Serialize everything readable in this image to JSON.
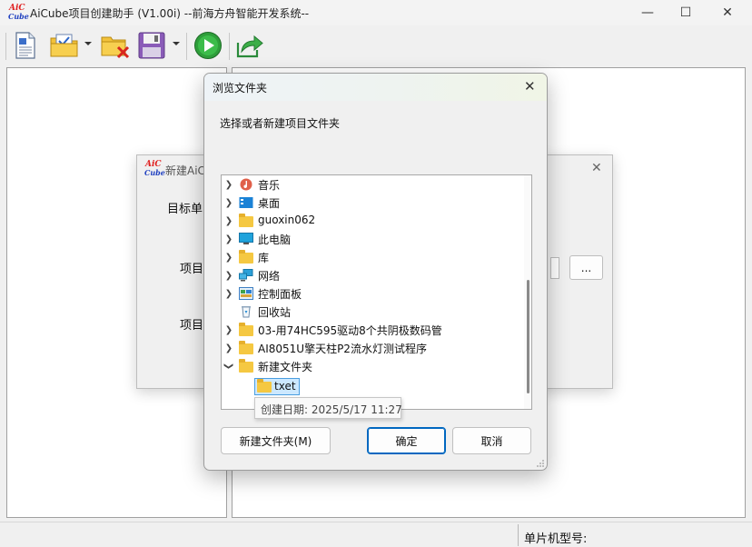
{
  "window": {
    "title": "AiCube项目创建助手 (V1.00i) --前海方舟智能开发系统--",
    "logo_top": "AiC",
    "logo_bottom": "Cube",
    "minimize": "—",
    "maximize": "☐",
    "close": "✕"
  },
  "toolbar": {
    "items": [
      "new-document-icon",
      "open-project-icon",
      "delete-folder-icon",
      "save-icon",
      "run-icon",
      "export-icon"
    ]
  },
  "status": {
    "mcu_label": "单片机型号:"
  },
  "bg_dialog": {
    "title": "新建AiC",
    "target_label": "目标单",
    "project_label_1": "项目",
    "project_label_2": "项目",
    "browse_button": "..."
  },
  "browse_dialog": {
    "title": "浏览文件夹",
    "close": "✕",
    "prompt": "选择或者新建项目文件夹",
    "tree": [
      {
        "label": "音乐",
        "icon": "music-icon",
        "expanded": false
      },
      {
        "label": "桌面",
        "icon": "desktop-icon",
        "expanded": false
      },
      {
        "label": "guoxin062",
        "icon": "folder-icon",
        "expanded": false
      },
      {
        "label": "此电脑",
        "icon": "computer-icon",
        "expanded": false
      },
      {
        "label": "库",
        "icon": "library-icon",
        "expanded": false
      },
      {
        "label": "网络",
        "icon": "network-icon",
        "expanded": false
      },
      {
        "label": "控制面板",
        "icon": "control-panel-icon",
        "expanded": false
      },
      {
        "label": "回收站",
        "icon": "recycle-bin-icon",
        "expanded": null
      },
      {
        "label": "03-用74HC595驱动8个共阴极数码管",
        "icon": "folder-icon",
        "expanded": false
      },
      {
        "label": "AI8051U擎天柱P2流水灯测试程序",
        "icon": "folder-icon",
        "expanded": false
      },
      {
        "label": "新建文件夹",
        "icon": "folder-icon",
        "expanded": true
      }
    ],
    "selected_child": "txet",
    "tooltip": "创建日期: 2025/5/17 11:27",
    "new_folder_button": "新建文件夹(M)",
    "ok_button": "确定",
    "cancel_button": "取消"
  },
  "colors": {
    "accent": "#0067c0",
    "selection": "#cce8ff",
    "folder": "#f5c842",
    "run_green": "#2e9e3a"
  }
}
